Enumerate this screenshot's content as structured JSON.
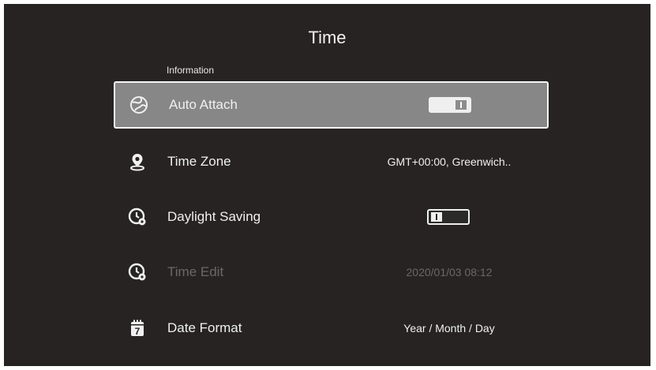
{
  "page": {
    "title": "Time",
    "section_label": "Information"
  },
  "rows": [
    {
      "label": "Auto Attach",
      "icon": "globe-icon",
      "control": "toggle",
      "toggle_on": true,
      "selected": true
    },
    {
      "label": "Time Zone",
      "icon": "location-pin-icon",
      "value": "GMT+00:00, Greenwich.."
    },
    {
      "label": "Daylight Saving",
      "icon": "clock-settings-icon",
      "control": "toggle",
      "toggle_on": false
    },
    {
      "label": "Time Edit",
      "icon": "clock-settings-icon",
      "value": "2020/01/03 08:12",
      "disabled": true
    },
    {
      "label": "Date Format",
      "icon": "calendar-icon",
      "value": "Year / Month / Day"
    }
  ],
  "colors": {
    "background": "#262322",
    "selected_row": "#878787",
    "text": "#f0f0f0",
    "disabled_text": "#6a6868"
  }
}
